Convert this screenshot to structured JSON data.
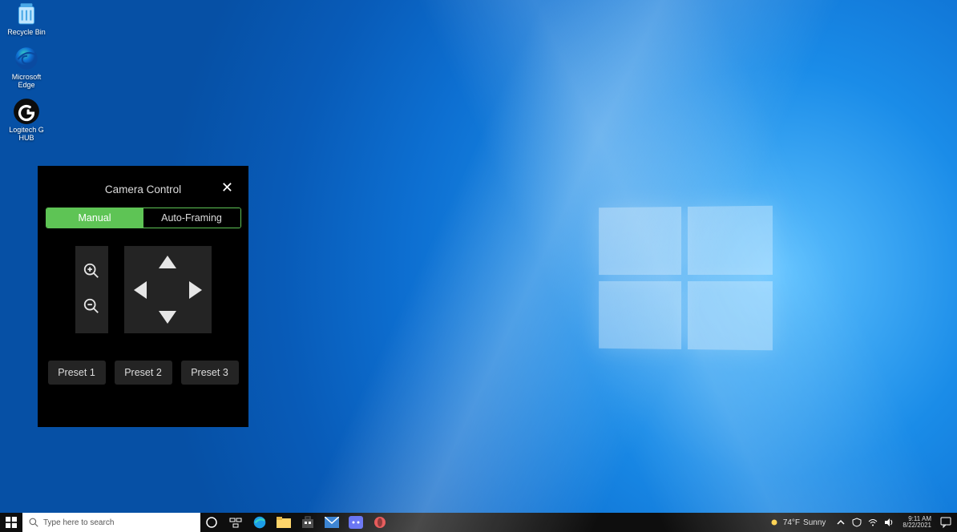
{
  "desktop": {
    "icons": [
      {
        "name": "recycle-bin",
        "label": "Recycle Bin"
      },
      {
        "name": "microsoft-edge",
        "label": "Microsoft Edge"
      },
      {
        "name": "logitech-g-hub",
        "label": "Logitech G HUB"
      }
    ]
  },
  "camera_control": {
    "title": "Camera Control",
    "tabs": {
      "manual": "Manual",
      "auto": "Auto-Framing",
      "active": "manual"
    },
    "presets": [
      "Preset 1",
      "Preset 2",
      "Preset 3"
    ]
  },
  "taskbar": {
    "search_placeholder": "Type here to search",
    "pinned": [
      {
        "name": "cortana-circle-icon"
      },
      {
        "name": "task-view-icon"
      },
      {
        "name": "microsoft-edge-icon"
      },
      {
        "name": "file-explorer-icon"
      },
      {
        "name": "microsoft-store-icon"
      },
      {
        "name": "mail-icon"
      },
      {
        "name": "discord-icon"
      },
      {
        "name": "opera-icon"
      }
    ],
    "weather": {
      "temp": "74°F",
      "label": "Sunny"
    },
    "clock": {
      "time": "9:11 AM",
      "date": "8/22/2021"
    }
  }
}
